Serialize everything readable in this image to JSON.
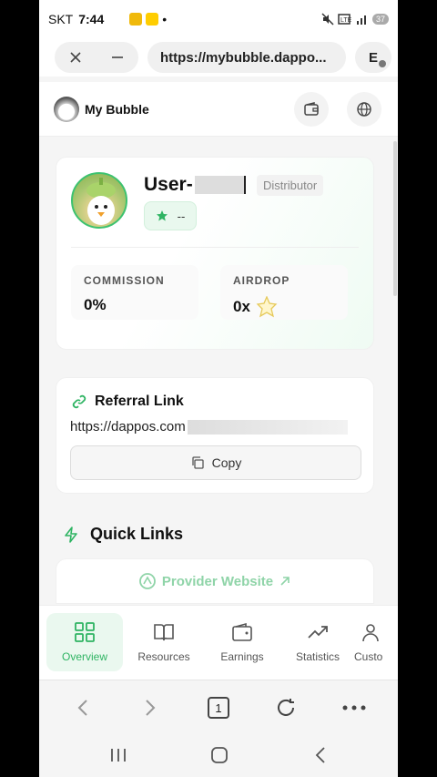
{
  "status": {
    "carrier": "SKT",
    "time": "7:44",
    "battery": "37"
  },
  "browser": {
    "url": "https://mybubble.dappo...",
    "ext_label": "E"
  },
  "app": {
    "name": "My Bubble"
  },
  "profile": {
    "username_prefix": "User-",
    "role": "Distributor",
    "level": "--",
    "commission_label": "COMMISSION",
    "commission_value": "0%",
    "airdrop_label": "AIRDROP",
    "airdrop_value": "0x"
  },
  "referral": {
    "title": "Referral Link",
    "link_prefix": "https://dappos.com",
    "copy_label": "Copy"
  },
  "quick_links": {
    "title": "Quick Links",
    "provider_label": "Provider Website"
  },
  "tabs": [
    {
      "label": "Overview",
      "icon": "grid-icon",
      "active": true
    },
    {
      "label": "Resources",
      "icon": "book-icon",
      "active": false
    },
    {
      "label": "Earnings",
      "icon": "wallet-icon",
      "active": false
    },
    {
      "label": "Statistics",
      "icon": "trend-up-icon",
      "active": false
    },
    {
      "label": "Custo",
      "icon": "person-icon",
      "active": false
    }
  ],
  "browser_nav": {
    "tab_count": "1"
  },
  "colors": {
    "accent": "#2fb463",
    "accent_light": "#eaf8ef"
  }
}
